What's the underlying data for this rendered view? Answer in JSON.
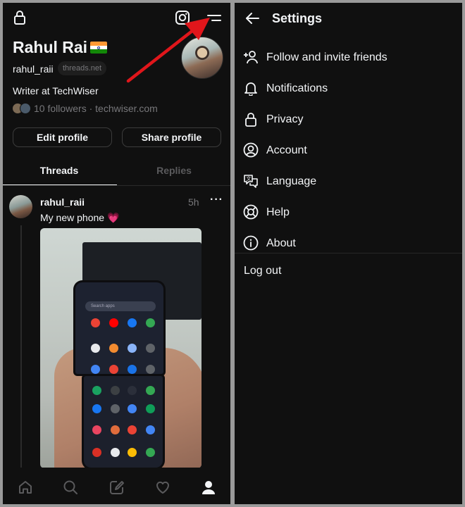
{
  "profile": {
    "name": "Rahul Rai",
    "username": "rahul_raii",
    "domain_pill": "threads.net",
    "bio": "Writer at TechWiser",
    "followers_text": "10 followers · techwiser.com",
    "edit_button": "Edit profile",
    "share_button": "Share profile"
  },
  "tabs": [
    {
      "label": "Threads",
      "active": true
    },
    {
      "label": "Replies",
      "active": false
    }
  ],
  "post": {
    "username": "rahul_raii",
    "time": "5h",
    "text": "My new phone 💗",
    "more": "···",
    "photo_search_placeholder": "Search apps"
  },
  "bottom_nav": [
    "home-icon",
    "search-icon",
    "compose-icon",
    "heart-icon",
    "profile-icon"
  ],
  "settings": {
    "title": "Settings",
    "items": [
      {
        "label": "Follow and invite friends",
        "icon": "add-person-icon"
      },
      {
        "label": "Notifications",
        "icon": "bell-icon"
      },
      {
        "label": "Privacy",
        "icon": "lock-icon"
      },
      {
        "label": "Account",
        "icon": "account-circle-icon"
      },
      {
        "label": "Language",
        "icon": "language-icon"
      },
      {
        "label": "Help",
        "icon": "lifebuoy-icon"
      },
      {
        "label": "About",
        "icon": "info-icon"
      }
    ],
    "logout": "Log out"
  },
  "colors": {
    "background": "#101010",
    "text": "#f3f5f7",
    "muted": "#77777a",
    "annotation_arrow": "#e0161b"
  }
}
